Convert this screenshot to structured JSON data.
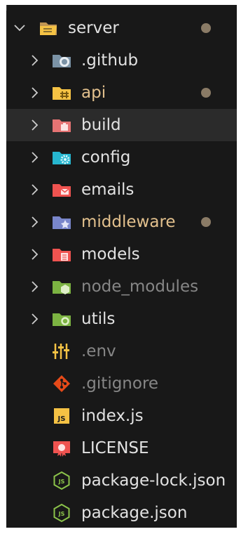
{
  "explorer": {
    "root": {
      "label": "server",
      "modified": true,
      "expanded": true,
      "icon": "folder-open-icon"
    },
    "items": [
      {
        "label": ".github",
        "type": "folder",
        "icon": "github-folder-icon",
        "modified": false,
        "dimmed": false,
        "selected": false
      },
      {
        "label": "api",
        "type": "folder",
        "icon": "api-folder-icon",
        "modified": true,
        "dimmed": false,
        "selected": false
      },
      {
        "label": "build",
        "type": "folder",
        "icon": "build-folder-icon",
        "modified": false,
        "dimmed": false,
        "selected": true
      },
      {
        "label": "config",
        "type": "folder",
        "icon": "config-folder-icon",
        "modified": false,
        "dimmed": false,
        "selected": false
      },
      {
        "label": "emails",
        "type": "folder",
        "icon": "emails-folder-icon",
        "modified": false,
        "dimmed": false,
        "selected": false
      },
      {
        "label": "middleware",
        "type": "folder",
        "icon": "middleware-folder-icon",
        "modified": true,
        "dimmed": false,
        "selected": false
      },
      {
        "label": "models",
        "type": "folder",
        "icon": "models-folder-icon",
        "modified": false,
        "dimmed": false,
        "selected": false
      },
      {
        "label": "node_modules",
        "type": "folder",
        "icon": "node-modules-folder-icon",
        "modified": false,
        "dimmed": true,
        "selected": false
      },
      {
        "label": "utils",
        "type": "folder",
        "icon": "utils-folder-icon",
        "modified": false,
        "dimmed": false,
        "selected": false
      },
      {
        "label": ".env",
        "type": "file",
        "icon": "env-file-icon",
        "modified": false,
        "dimmed": true,
        "selected": false
      },
      {
        "label": ".gitignore",
        "type": "file",
        "icon": "git-file-icon",
        "modified": false,
        "dimmed": true,
        "selected": false
      },
      {
        "label": "index.js",
        "type": "file",
        "icon": "javascript-file-icon",
        "modified": false,
        "dimmed": false,
        "selected": false
      },
      {
        "label": "LICENSE",
        "type": "file",
        "icon": "license-file-icon",
        "modified": false,
        "dimmed": false,
        "selected": false
      },
      {
        "label": "package-lock.json",
        "type": "file",
        "icon": "nodejs-file-icon",
        "modified": false,
        "dimmed": false,
        "selected": false
      },
      {
        "label": "package.json",
        "type": "file",
        "icon": "nodejs-file-icon",
        "modified": false,
        "dimmed": false,
        "selected": false
      }
    ]
  },
  "colors": {
    "background": "#181818",
    "selected_row": "#2b2b2b",
    "text": "#e2e2e2",
    "text_dimmed": "#868686",
    "text_modified": "#e2c08d",
    "modified_dot": "#8a7b66"
  }
}
